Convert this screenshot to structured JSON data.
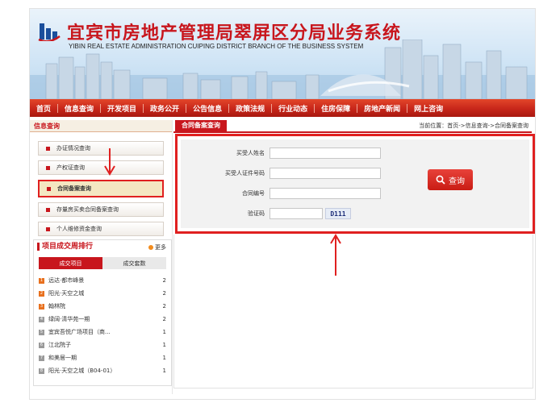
{
  "header": {
    "title_cn": "宜宾市房地产管理局翠屏区分局业务系统",
    "title_en": "YIBIN REAL ESTATE ADMINISTRATION CUIPING DISTRICT BRANCH OF THE BUSINESS SYSTEM"
  },
  "nav": {
    "items": [
      "首页",
      "信息查询",
      "开发项目",
      "政务公开",
      "公告信息",
      "政策法规",
      "行业动态",
      "住房保障",
      "房地产新闻",
      "网上咨询"
    ]
  },
  "sidebar": {
    "title": "信息查询",
    "items": [
      {
        "label": "办证情况查询",
        "active": false
      },
      {
        "label": "产权证查询",
        "active": false
      },
      {
        "label": "合同备案查询",
        "active": true
      },
      {
        "label": "存量房买卖合同备案查询",
        "active": false
      },
      {
        "label": "个人维修资金查询",
        "active": false
      }
    ]
  },
  "ranking": {
    "title": "项目成交周排行",
    "more": "更多",
    "tabs": [
      "成交项目",
      "成交套数"
    ],
    "rows": [
      {
        "rank": "1",
        "name": "远达·都市峰景",
        "count": "2",
        "color": "#e8701e"
      },
      {
        "rank": "2",
        "name": "阳光·天空之城",
        "count": "2",
        "color": "#e8701e"
      },
      {
        "rank": "3",
        "name": "翰林院",
        "count": "2",
        "color": "#e8701e"
      },
      {
        "rank": "4",
        "name": "绿阔·清华苑一期",
        "count": "2",
        "color": "#9a9a9a"
      },
      {
        "rank": "5",
        "name": "宜宾吾悦广场项目（商...",
        "count": "1",
        "color": "#9a9a9a"
      },
      {
        "rank": "6",
        "name": "江北院子",
        "count": "1",
        "color": "#9a9a9a"
      },
      {
        "rank": "7",
        "name": "和美居一期",
        "count": "1",
        "color": "#9a9a9a"
      },
      {
        "rank": "8",
        "name": "阳光·天空之城（B04-01）",
        "count": "1",
        "color": "#9a9a9a"
      }
    ]
  },
  "main": {
    "tab_label": "合同备案查询",
    "breadcrumb": "当前位置：首页->信息查询->合同备案查询",
    "form": {
      "buyer_name_label": "买受人姓名",
      "buyer_id_label": "买受人证件号码",
      "contract_no_label": "合同编号",
      "captcha_label": "验证码",
      "captcha_text": "D111",
      "query_button": "查询"
    }
  },
  "colors": {
    "brand_red": "#c8161d",
    "highlight_red": "#e02020"
  }
}
